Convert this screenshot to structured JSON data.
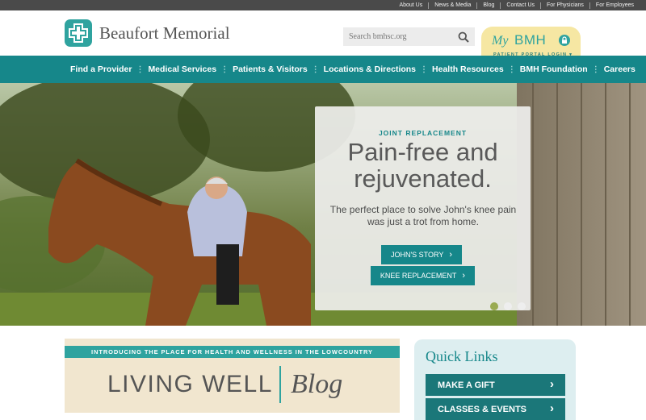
{
  "utility": {
    "links": [
      "About Us",
      "News & Media",
      "Blog",
      "Contact Us",
      "For Physicians",
      "For Employees"
    ]
  },
  "header": {
    "logo_text": "Beaufort Memorial",
    "search_placeholder": "Search bmhsc.org",
    "portal": {
      "my": "My",
      "bmh": "BMH",
      "sub": "PATIENT PORTAL LOGIN ▾"
    }
  },
  "nav": {
    "items": [
      "Find a Provider",
      "Medical Services",
      "Patients & Visitors",
      "Locations & Directions",
      "Health Resources",
      "BMH Foundation",
      "Careers"
    ]
  },
  "hero": {
    "eyebrow": "JOINT REPLACEMENT",
    "title_line1": "Pain-free and",
    "title_line2": "rejuvenated.",
    "description": "The perfect place to solve John's knee pain was just a trot from home.",
    "buttons": [
      "JOHN'S STORY",
      "KNEE REPLACEMENT"
    ],
    "slide_count": 3,
    "active_slide": 1
  },
  "blog_banner": {
    "strip": "INTRODUCING THE PLACE FOR HEALTH AND WELLNESS IN THE LOWCOUNTRY",
    "living": "LIVING WELL",
    "word": "Blog"
  },
  "quick_links": {
    "title": "Quick Links",
    "items": [
      "MAKE A GIFT",
      "CLASSES & EVENTS"
    ]
  },
  "colors": {
    "teal": "#16878a",
    "portal_yellow": "#f6e7a3",
    "accent_green": "#9aab52"
  },
  "icons": [
    "logo-cross-icon",
    "search-icon",
    "lock-icon",
    "chevron-right-icon"
  ]
}
